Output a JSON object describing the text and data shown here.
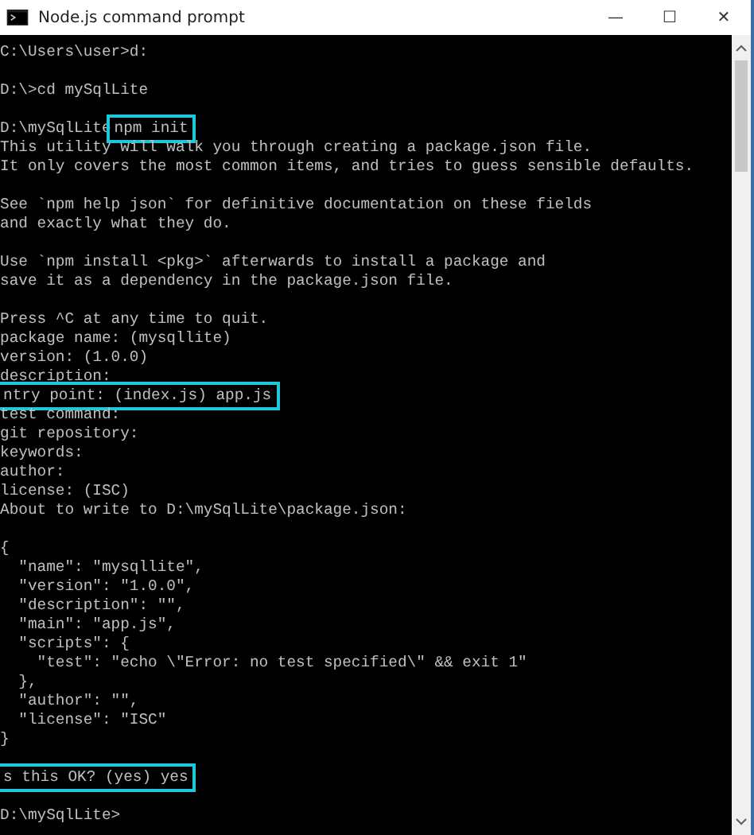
{
  "window": {
    "title": "Node.js command prompt",
    "buttons": [
      "—",
      "☐",
      "✕"
    ]
  },
  "console": [
    {
      "kind": "text",
      "parts": [
        {
          "text": "C:\\Users\\user>d:",
          "boxed": false
        }
      ]
    },
    {
      "kind": "blank"
    },
    {
      "kind": "text",
      "parts": [
        {
          "text": "D:\\>cd mySqlLite",
          "boxed": false
        }
      ]
    },
    {
      "kind": "blank"
    },
    {
      "kind": "text",
      "parts": [
        {
          "text": "D:\\mySqlLite",
          "boxed": false
        },
        {
          "text": "npm init",
          "boxed": true
        }
      ]
    },
    {
      "kind": "text",
      "parts": [
        {
          "text": "This utility will walk you through creating a package.json file.",
          "boxed": false
        }
      ]
    },
    {
      "kind": "text",
      "parts": [
        {
          "text": "It only covers the most common items, and tries to guess sensible defaults.",
          "boxed": false
        }
      ]
    },
    {
      "kind": "blank"
    },
    {
      "kind": "text",
      "parts": [
        {
          "text": "See `npm help json` for definitive documentation on these fields",
          "boxed": false
        }
      ]
    },
    {
      "kind": "text",
      "parts": [
        {
          "text": "and exactly what they do.",
          "boxed": false
        }
      ]
    },
    {
      "kind": "blank"
    },
    {
      "kind": "text",
      "parts": [
        {
          "text": "Use `npm install <pkg>` afterwards to install a package and",
          "boxed": false
        }
      ]
    },
    {
      "kind": "text",
      "parts": [
        {
          "text": "save it as a dependency in the package.json file.",
          "boxed": false
        }
      ]
    },
    {
      "kind": "blank"
    },
    {
      "kind": "text",
      "parts": [
        {
          "text": "Press ^C at any time to quit.",
          "boxed": false
        }
      ]
    },
    {
      "kind": "text",
      "parts": [
        {
          "text": "package name: (mysqllite)",
          "boxed": false
        }
      ]
    },
    {
      "kind": "text",
      "parts": [
        {
          "text": "version: (1.0.0)",
          "boxed": false
        }
      ]
    },
    {
      "kind": "text",
      "parts": [
        {
          "text": "description:",
          "boxed": false
        }
      ]
    },
    {
      "kind": "text",
      "parts": [
        {
          "text": "ntry point: (index.js) app.js",
          "boxed": true
        }
      ]
    },
    {
      "kind": "text",
      "parts": [
        {
          "text": "test command:",
          "boxed": false
        }
      ]
    },
    {
      "kind": "text",
      "parts": [
        {
          "text": "git repository:",
          "boxed": false
        }
      ]
    },
    {
      "kind": "text",
      "parts": [
        {
          "text": "keywords:",
          "boxed": false
        }
      ]
    },
    {
      "kind": "text",
      "parts": [
        {
          "text": "author:",
          "boxed": false
        }
      ]
    },
    {
      "kind": "text",
      "parts": [
        {
          "text": "license: (ISC)",
          "boxed": false
        }
      ]
    },
    {
      "kind": "text",
      "parts": [
        {
          "text": "About to write to D:\\mySqlLite\\package.json:",
          "boxed": false
        }
      ]
    },
    {
      "kind": "blank"
    },
    {
      "kind": "text",
      "parts": [
        {
          "text": "{",
          "boxed": false
        }
      ]
    },
    {
      "kind": "text",
      "parts": [
        {
          "text": "  \"name\": \"mysqllite\",",
          "boxed": false
        }
      ]
    },
    {
      "kind": "text",
      "parts": [
        {
          "text": "  \"version\": \"1.0.0\",",
          "boxed": false
        }
      ]
    },
    {
      "kind": "text",
      "parts": [
        {
          "text": "  \"description\": \"\",",
          "boxed": false
        }
      ]
    },
    {
      "kind": "text",
      "parts": [
        {
          "text": "  \"main\": \"app.js\",",
          "boxed": false
        }
      ]
    },
    {
      "kind": "text",
      "parts": [
        {
          "text": "  \"scripts\": {",
          "boxed": false
        }
      ]
    },
    {
      "kind": "text",
      "parts": [
        {
          "text": "    \"test\": \"echo \\\"Error: no test specified\\\" && exit 1\"",
          "boxed": false
        }
      ]
    },
    {
      "kind": "text",
      "parts": [
        {
          "text": "  },",
          "boxed": false
        }
      ]
    },
    {
      "kind": "text",
      "parts": [
        {
          "text": "  \"author\": \"\",",
          "boxed": false
        }
      ]
    },
    {
      "kind": "text",
      "parts": [
        {
          "text": "  \"license\": \"ISC\"",
          "boxed": false
        }
      ]
    },
    {
      "kind": "text",
      "parts": [
        {
          "text": "}",
          "boxed": false
        }
      ]
    },
    {
      "kind": "blank"
    },
    {
      "kind": "text",
      "parts": [
        {
          "text": "s this OK? (yes) yes",
          "boxed": true
        }
      ]
    },
    {
      "kind": "blank"
    },
    {
      "kind": "text",
      "parts": [
        {
          "text": "D:\\mySqlLite>",
          "boxed": false
        }
      ]
    }
  ]
}
